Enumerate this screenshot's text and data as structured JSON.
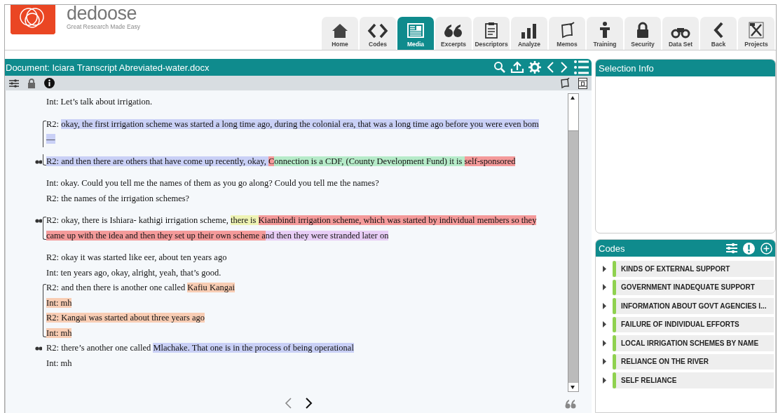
{
  "brand": {
    "name": "dedoose",
    "tagline": "Great Research Made Easy"
  },
  "nav_tabs": [
    {
      "label": "Home",
      "selected": false
    },
    {
      "label": "Codes",
      "selected": false
    },
    {
      "label": "Media",
      "selected": true
    },
    {
      "label": "Excerpts",
      "selected": false
    },
    {
      "label": "Descriptors",
      "selected": false
    },
    {
      "label": "Analyze",
      "selected": false
    },
    {
      "label": "Memos",
      "selected": false
    },
    {
      "label": "Training",
      "selected": false
    },
    {
      "label": "Security",
      "selected": false
    },
    {
      "label": "Data Set",
      "selected": false
    },
    {
      "label": "Back",
      "selected": false
    },
    {
      "label": "Projects",
      "selected": false
    }
  ],
  "document": {
    "title": "Document: Iciara Transcript Abreviated-water.docx",
    "paragraphs": [
      {
        "lines": [
          {
            "kind": "plain",
            "quote_mark": false,
            "segments": [
              {
                "text": "Int: Let’s talk about irrigation."
              }
            ]
          }
        ]
      },
      {
        "lines": [
          {
            "kind": "open",
            "quote_mark": false,
            "segments": [
              {
                "text": "R2: "
              },
              {
                "text": "okay, the first irrigation scheme was started a long time ago, during the colonial era, that was a long time ago before you were even bom",
                "color": "#c9d0f6"
              }
            ]
          },
          {
            "kind": "continue",
            "quote_mark": false,
            "segments": [
              {
                "text": "—",
                "color": "#c9d0f6"
              }
            ]
          }
        ]
      },
      {
        "lines": [
          {
            "kind": "close",
            "quote_mark": true,
            "segments": [
              {
                "text": "R2: and then there are others that have come up recently, okay, ",
                "color": "#c9d0f6"
              },
              {
                "text": "C",
                "color": "#f49a9a"
              },
              {
                "text": "onnection is a CDF, (County Development Fund) it is ",
                "color": "#b6ebc9"
              },
              {
                "text": "self-sponsored",
                "color": "#f49a9a"
              }
            ]
          }
        ]
      },
      {
        "lines": [
          {
            "kind": "plain",
            "quote_mark": false,
            "segments": [
              {
                "text": "Int: okay. Could you tell me the names of them as you go along? Could you tell me the names?"
              }
            ]
          },
          {
            "kind": "plain",
            "quote_mark": false,
            "segments": [
              {
                "text": "R2:  the names of the irrigation schemes?"
              }
            ]
          }
        ]
      },
      {
        "lines": [
          {
            "kind": "open",
            "quote_mark": true,
            "segments": [
              {
                "text": "R2: okay, there is Ishiara- kathigi irrigation scheme, "
              },
              {
                "text": "there is ",
                "color": "#eef3b4"
              },
              {
                "text": "Kiambindi irrigation scheme, which was started by individual members so they",
                "color": "#f49a9a"
              }
            ]
          },
          {
            "kind": "close",
            "quote_mark": false,
            "segments": [
              {
                "text": "came up with the idea and then they set up their own scheme a",
                "color": "#f49a9a"
              },
              {
                "text": "nd then they were stranded later on",
                "color": "#e8cdf6"
              }
            ]
          }
        ]
      },
      {
        "lines": [
          {
            "kind": "plain",
            "quote_mark": false,
            "segments": [
              {
                "text": "R2: okay it was started like eer, about ten years ago"
              }
            ]
          },
          {
            "kind": "plain",
            "quote_mark": false,
            "segments": [
              {
                "text": "Int: ten years ago, okay, alright, yeah, that’s good."
              }
            ]
          },
          {
            "kind": "open",
            "quote_mark": false,
            "segments": [
              {
                "text": "R2: and then there is another one called "
              },
              {
                "text": "Kafiu Kangai",
                "color": "#f8cdb4"
              }
            ]
          },
          {
            "kind": "continue",
            "quote_mark": false,
            "segments": [
              {
                "text": "Int: mh",
                "color": "#f8cdb4"
              }
            ]
          },
          {
            "kind": "continue",
            "quote_mark": false,
            "segments": [
              {
                "text": "R2: Kangai was started about three years ago",
                "color": "#f8cdb4"
              }
            ]
          },
          {
            "kind": "close",
            "quote_mark": false,
            "segments": [
              {
                "text": "Int: mh",
                "color": "#f8cdb4"
              }
            ]
          },
          {
            "kind": "plain",
            "quote_mark": true,
            "segments": [
              {
                "text": "R2: there’s another one called "
              },
              {
                "text": "Mlachake. That one is in the process of being operational",
                "color": "#c9d0f6"
              }
            ]
          },
          {
            "kind": "plain",
            "quote_mark": false,
            "segments": [
              {
                "text": "Int: mh"
              }
            ]
          }
        ]
      }
    ]
  },
  "selection_info": {
    "title": "Selection Info"
  },
  "codes": {
    "title": "Codes",
    "items": [
      {
        "label": "KINDS OF EXTERNAL SUPPORT",
        "color": "#8fd14f"
      },
      {
        "label": "GOVERNMENT INADEQUATE SUPPORT",
        "color": "#8fd14f"
      },
      {
        "label": "INFORMATION ABOUT GOVT AGENCIES I...",
        "color": "#8fd14f"
      },
      {
        "label": "FAILURE OF INDIVIDUAL EFFORTS",
        "color": "#8fd14f"
      },
      {
        "label": "LOCAL IRRIGATION SCHEMES BY NAME",
        "color": "#8fd14f"
      },
      {
        "label": "RELIANCE ON THE RIVER",
        "color": "#8fd14f"
      },
      {
        "label": "SELF RELIANCE",
        "color": "#8fd14f"
      }
    ]
  }
}
